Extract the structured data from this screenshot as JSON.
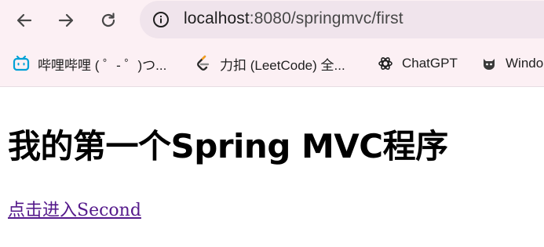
{
  "browser": {
    "url_host": "localhost",
    "url_rest": ":8080/springmvc/first",
    "nav_icons": [
      "arrow-left-icon",
      "arrow-right-icon",
      "reload-icon",
      "info-icon"
    ]
  },
  "bookmarks": [
    {
      "label": "哔哩哔哩 ( ゜- ゜)つ...",
      "icon": "bilibili-icon",
      "color": "#00a1d6"
    },
    {
      "label": "力扣 (LeetCode) 全...",
      "icon": "leetcode-icon",
      "color": "#f89f1b"
    },
    {
      "label": "ChatGPT",
      "icon": "chatgpt-icon",
      "color": "#1f1f1f"
    },
    {
      "label": "Windo",
      "icon": "github-cat-icon",
      "color": "#1f1f1f"
    }
  ],
  "page": {
    "title": "我的第一个Spring MVC程序",
    "link_text": "点击进入Second",
    "link_color": "#551a8b"
  },
  "colors": {
    "chrome_bg": "#fcf0f4",
    "omnibox_bg": "#f0e4ec"
  }
}
